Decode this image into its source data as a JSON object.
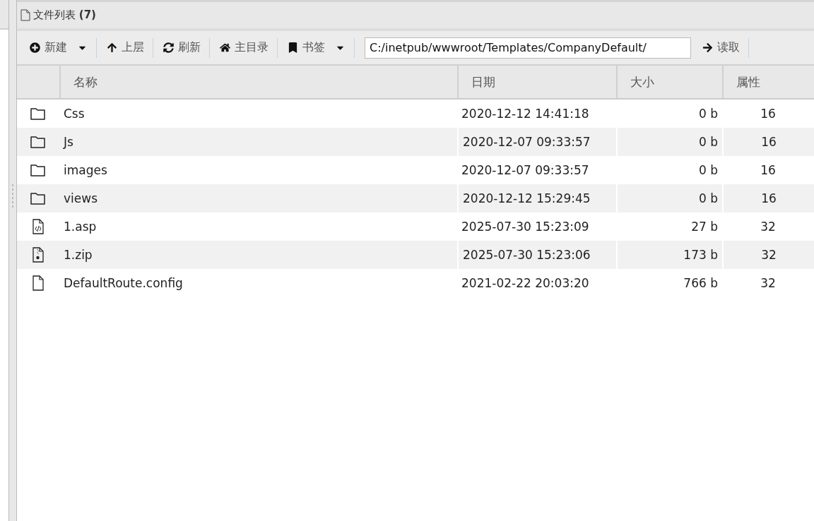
{
  "panel": {
    "title": "文件列表",
    "count": "(7)"
  },
  "toolbar": {
    "buttons": [
      {
        "kind": "new",
        "label": "新建",
        "dropdown": true
      },
      {
        "kind": "up",
        "label": "上层",
        "dropdown": false
      },
      {
        "kind": "refresh",
        "label": "刷新",
        "dropdown": false
      },
      {
        "kind": "home",
        "label": "主目录",
        "dropdown": false
      },
      {
        "kind": "bookmark",
        "label": "书签",
        "dropdown": true
      }
    ],
    "path": "C:/inetpub/wwwroot/Templates/CompanyDefault/",
    "read_button": "读取"
  },
  "table": {
    "columns": [
      "名称",
      "日期",
      "大小",
      "属性"
    ],
    "rows": [
      {
        "kind": "folder",
        "name": "Css",
        "date": "2020-12-12 14:41:18",
        "size": "0 b",
        "attr": "16"
      },
      {
        "kind": "folder",
        "name": "Js",
        "date": "2020-12-07 09:33:57",
        "size": "0 b",
        "attr": "16"
      },
      {
        "kind": "folder",
        "name": "images",
        "date": "2020-12-07 09:33:57",
        "size": "0 b",
        "attr": "16"
      },
      {
        "kind": "folder",
        "name": "views",
        "date": "2020-12-12 15:29:45",
        "size": "0 b",
        "attr": "16"
      },
      {
        "kind": "code",
        "name": "1.asp",
        "date": "2025-07-30 15:23:09",
        "size": "27 b",
        "attr": "32"
      },
      {
        "kind": "zip",
        "name": "1.zip",
        "date": "2025-07-30 15:23:06",
        "size": "173 b",
        "attr": "32"
      },
      {
        "kind": "file",
        "name": "DefaultRoute.config",
        "date": "2021-02-22 20:03:20",
        "size": "766 b",
        "attr": "32"
      }
    ]
  }
}
